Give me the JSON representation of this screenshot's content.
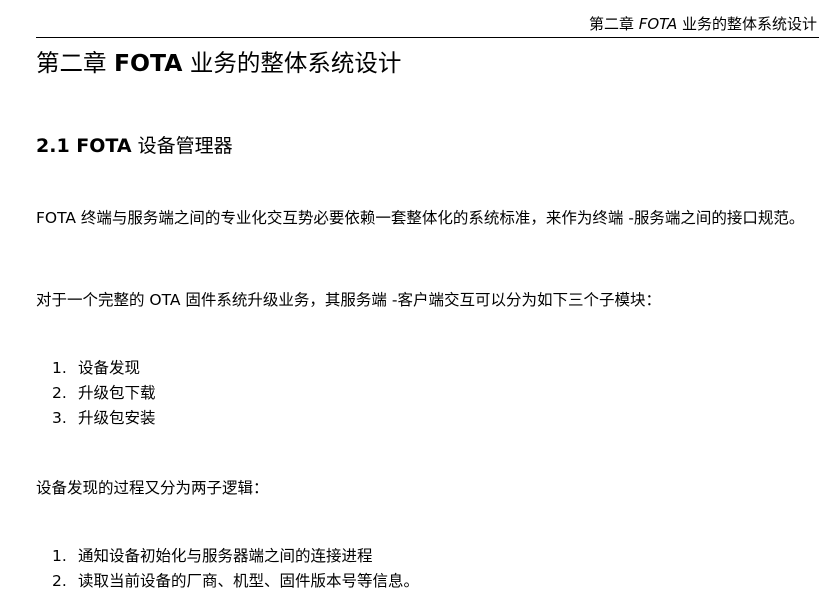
{
  "running_header": {
    "prefix": "第二章 ",
    "fota": "FOTA",
    "suffix": " 业务的整体系统设计"
  },
  "chapter": {
    "prefix": "第二章 ",
    "bold": "FOTA",
    "suffix": " 业务的整体系统设计"
  },
  "section": {
    "bold": "2.1 FOTA",
    "suffix": " 设备管理器"
  },
  "paragraphs": [
    "FOTA 终端与服务端之间的专业化交互势必要依赖一套整体化的系统标准，来作为终端 -服务端之间的接口规范。",
    "对于一个完整的 OTA 固件系统升级业务，其服务端 -客户端交互可以分为如下三个子模块：",
    "设备发现的过程又分为两子逻辑："
  ],
  "list1": [
    {
      "num": "1.",
      "text": "设备发现"
    },
    {
      "num": "2.",
      "text": "升级包下载"
    },
    {
      "num": "3.",
      "text": "升级包安装"
    }
  ],
  "list2": [
    {
      "num": "1.",
      "text": "通知设备初始化与服务器端之间的连接进程"
    },
    {
      "num": "2.",
      "text": "读取当前设备的厂商、机型、固件版本号等信息。"
    }
  ]
}
